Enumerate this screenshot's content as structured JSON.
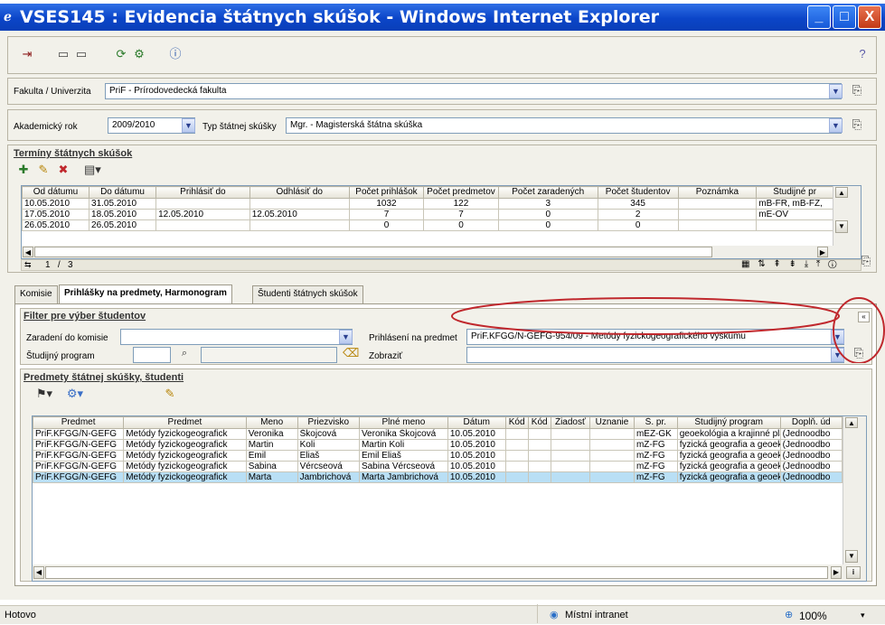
{
  "window": {
    "title": "VSES145 : Evidencia štátnych skúšok - Windows Internet Explorer",
    "minimize": "_",
    "maximize": "□",
    "close": "X"
  },
  "toolbar": {
    "icons": [
      "exit-icon",
      "print-icon",
      "print-preview-icon",
      "refresh-icon",
      "export-icon",
      "info-icon",
      "help-icon"
    ]
  },
  "fakulta": {
    "label": "Fakulta / Univerzita",
    "value": "PriF - Prírodovedecká fakulta"
  },
  "rok": {
    "label": "Akademický rok",
    "value": "2009/2010"
  },
  "typ": {
    "label": "Typ štátnej skúšky",
    "value": "Mgr. - Magisterská štátna skúška"
  },
  "terminy": {
    "title": "Termíny štátnych skúšok",
    "columns": [
      "Od dátumu",
      "Do dátumu",
      "Prihlásiť do",
      "Odhlásiť do",
      "Počet prihlášok",
      "Počet predmetov",
      "Počet zaradených",
      "Počet študentov",
      "Poznámka",
      "Študijné pr"
    ],
    "rows": [
      [
        "10.05.2010",
        "31.05.2010",
        "",
        "",
        "1032",
        "122",
        "3",
        "345",
        "",
        "mB-FR, mB-FZ,"
      ],
      [
        "17.05.2010",
        "18.05.2010",
        "12.05.2010",
        "12.05.2010",
        "7",
        "7",
        "0",
        "2",
        "",
        "mE-OV"
      ],
      [
        "26.05.2010",
        "26.05.2010",
        "",
        "",
        "0",
        "0",
        "0",
        "0",
        "",
        ""
      ]
    ],
    "pager": "1   /   3"
  },
  "tabs": [
    "Komisie",
    "Prihlášky na predmety, Harmonogram",
    "Študenti štátnych skúšok"
  ],
  "filter": {
    "title": "Filter pre výber študentov",
    "komisia_label": "Zaradení do komisie",
    "komisia_value": "",
    "predmet_label": "Prihlásení na predmet",
    "predmet_value": "PriF.KFGG/N-GEFG-954/09 - Metódy fyzickogeografického výskumu",
    "program_label": "Študijný program",
    "zobrazit_label": "Zobraziť",
    "zobrazit_value": ""
  },
  "students": {
    "title": "Predmety štátnej skúšky, študenti",
    "columns": [
      "Predmet",
      "Predmet",
      "Meno",
      "Priezvisko",
      "Plné meno",
      "Dátum",
      "Kód",
      "Kód",
      "Žiadosť",
      "Uznanie",
      "Š. pr.",
      "Študijný program",
      "Doplň. úd"
    ],
    "rows": [
      [
        "PriF.KFGG/N-GEFG",
        "Metódy fyzickogeografick",
        "Veronika",
        "Škojcová",
        "Veronika Škojcová",
        "10.05.2010",
        "",
        "",
        "",
        "",
        "mEZ-GK",
        "geoekológia a krajinné plánov",
        "(Jednoodbo"
      ],
      [
        "PriF.KFGG/N-GEFG",
        "Metódy fyzickogeografick",
        "Martin",
        "Koli",
        "Martin Koli",
        "10.05.2010",
        "",
        "",
        "",
        "",
        "mZ-FG",
        "fyzická geografia a geoekoló",
        "(Jednoodbo"
      ],
      [
        "PriF.KFGG/N-GEFG",
        "Metódy fyzickogeografick",
        "Emil",
        "Eliaš",
        "Emil Eliaš",
        "10.05.2010",
        "",
        "",
        "",
        "",
        "mZ-FG",
        "fyzická geografia a geoekoló",
        "(Jednoodbo"
      ],
      [
        "PriF.KFGG/N-GEFG",
        "Metódy fyzickogeografick",
        "Sabina",
        "Vércseová",
        "Sabina Vércseová",
        "10.05.2010",
        "",
        "",
        "",
        "",
        "mZ-FG",
        "fyzická geografia a geoekoló",
        "(Jednoodbo"
      ],
      [
        "PriF.KFGG/N-GEFG",
        "Metódy fyzickogeografick",
        "Marta",
        "Jambrichová",
        "Marta Jambrichová",
        "10.05.2010",
        "",
        "",
        "",
        "",
        "mZ-FG",
        "fyzická geografia a geoekoló",
        "(Jednoodbo"
      ]
    ]
  },
  "status": {
    "left": "Hotovo",
    "zone": "Místní intranet",
    "zoom": "100%"
  },
  "colors": {
    "highlight_circle": "#c0282d",
    "selected_row": "#b9dff5",
    "titlebar": "#0b45c8"
  }
}
